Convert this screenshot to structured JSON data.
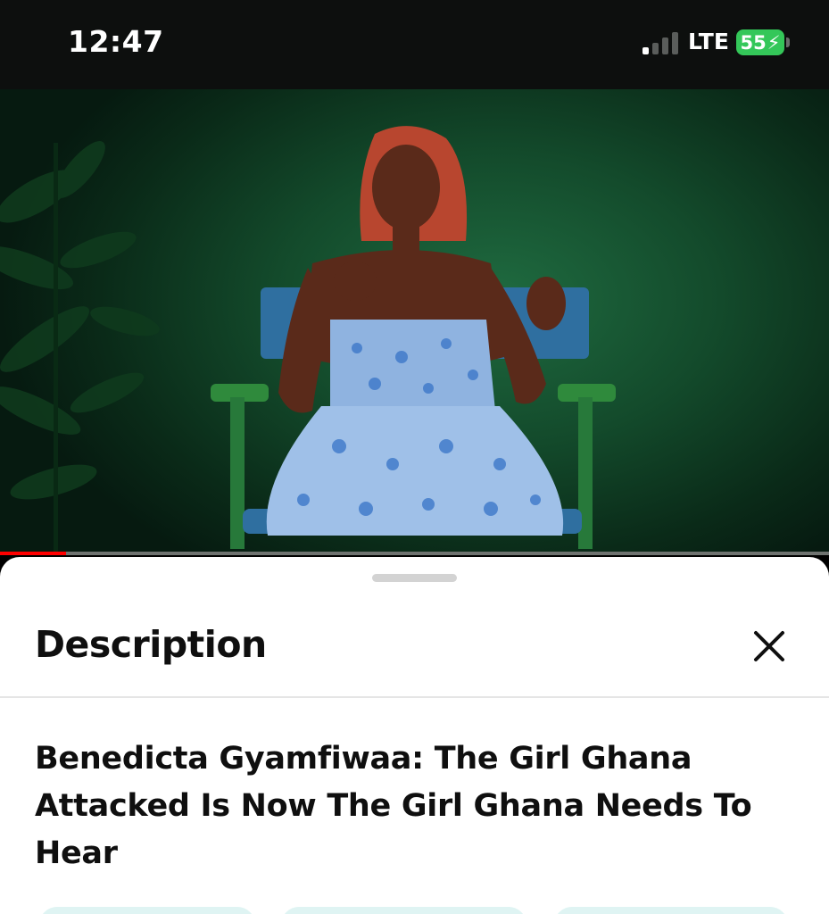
{
  "status_bar": {
    "time": "12:47",
    "network": "LTE",
    "battery_level": "55",
    "battery_charging_glyph": "⚡",
    "battery_color": "#34c759"
  },
  "video": {
    "scene_colors": {
      "background": "#134a2b",
      "hair": "#b8462f",
      "skin": "#5a2a1a",
      "dress": "#8fb3e0",
      "chair_fabric": "#2f6fa0",
      "chair_frame": "#2f8a3c"
    },
    "progress_fraction": 0.08,
    "progress_color": "#ff0000"
  },
  "description_panel": {
    "heading": "Description",
    "close_icon": "close-icon",
    "video_title": "Benedicta Gyamfiwaa: The Girl Ghana Attacked Is Now The Girl Ghana Needs To Hear",
    "chip_color": "#dff4f3"
  }
}
